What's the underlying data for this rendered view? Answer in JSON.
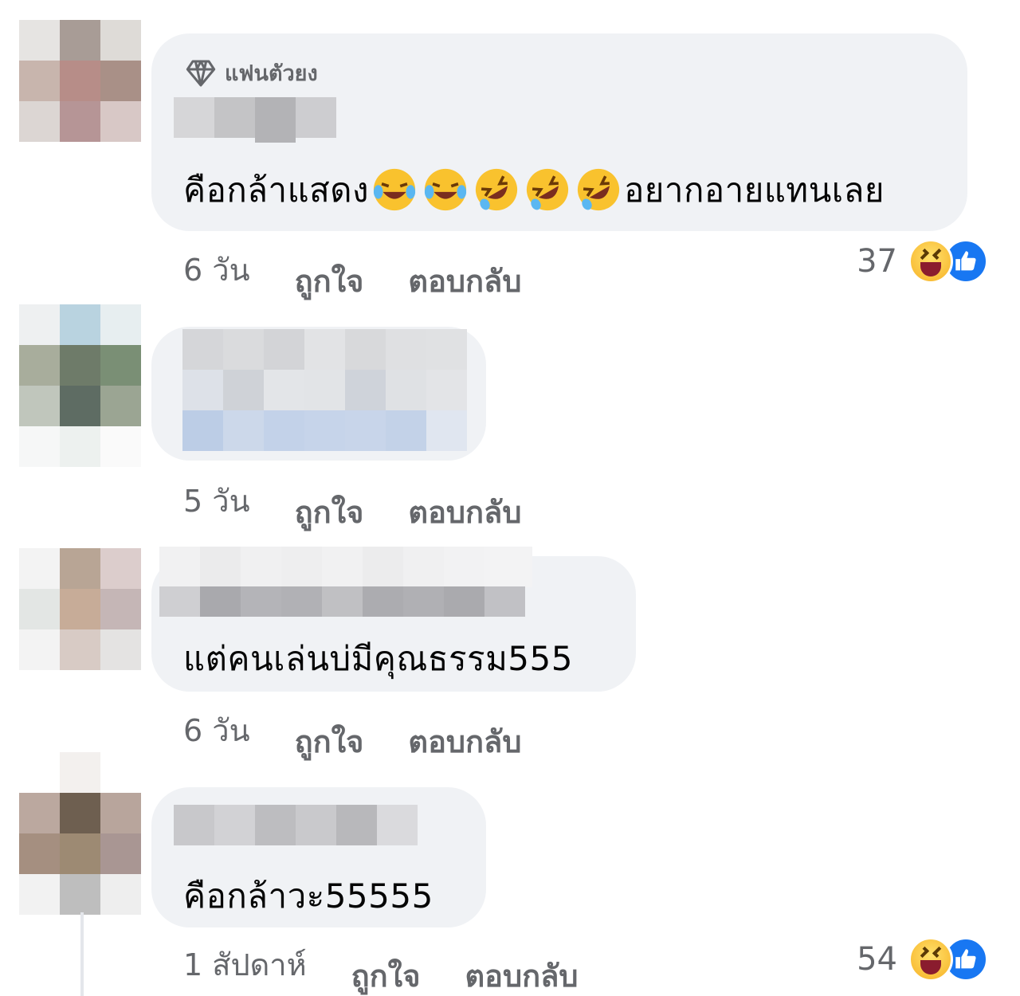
{
  "comments": [
    {
      "badge": "แฟนตัวยง",
      "text_before": "คือกล้าแสดง",
      "emojis": [
        "face-with-tears-of-joy",
        "face-with-tears-of-joy",
        "rolling-on-floor-laughing",
        "rolling-on-floor-laughing",
        "rolling-on-floor-laughing"
      ],
      "text_after": "อยากอายแทนเลย",
      "time": "6 วัน",
      "like": "ถูกใจ",
      "reply": "ตอบกลับ",
      "reaction_count": "37",
      "reactions": [
        "haha-icon",
        "like-icon"
      ]
    },
    {
      "text": "",
      "time": "5 วัน",
      "like": "ถูกใจ",
      "reply": "ตอบกลับ"
    },
    {
      "text": "แต่คนเล่นบ่มีคุณธรรม555",
      "time": "6 วัน",
      "like": "ถูกใจ",
      "reply": "ตอบกลับ"
    },
    {
      "text": "คือกล้าวะ55555",
      "time": "1 สัปดาห์",
      "like": "ถูกใจ",
      "reply": "ตอบกลับ",
      "reaction_count": "54",
      "reactions": [
        "haha-icon",
        "like-icon"
      ]
    }
  ],
  "colors": {
    "bubble": "#f0f2f5",
    "meta_text": "#65676b",
    "like_blue": "#1877f2",
    "haha_yellow": "#f7b125"
  }
}
